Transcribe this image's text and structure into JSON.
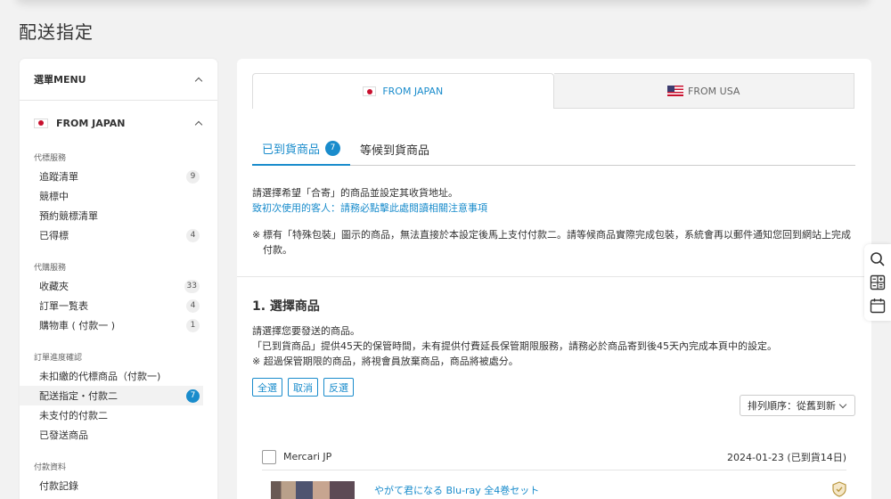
{
  "page_title": "配送指定",
  "sidebar": {
    "menu_title": "選單MENU",
    "country_label": "FROM JAPAN",
    "sections": [
      {
        "title": "代標服務",
        "items": [
          {
            "label": "追蹤清單",
            "count": "9"
          },
          {
            "label": "競標中",
            "count": ""
          },
          {
            "label": "預約競標清單",
            "count": ""
          },
          {
            "label": "已得標",
            "count": "4"
          }
        ]
      },
      {
        "title": "代購服務",
        "items": [
          {
            "label": "收藏夾",
            "count": "33"
          },
          {
            "label": "訂單一覧表",
            "count": "4"
          },
          {
            "label": "購物車 ( 付款一 )",
            "count": "1"
          }
        ]
      },
      {
        "title": "訂單進度確認",
        "items": [
          {
            "label": "未扣繳的代標商品（付款一)",
            "count": ""
          },
          {
            "label": "配送指定・付款二",
            "count": "7"
          },
          {
            "label": "未支付的付款二",
            "count": ""
          },
          {
            "label": "已發送商品",
            "count": ""
          }
        ]
      },
      {
        "title": "付款資料",
        "items": [
          {
            "label": "付款記錄",
            "count": ""
          },
          {
            "label": "押金",
            "count": ""
          }
        ]
      }
    ]
  },
  "country_tabs": [
    {
      "label": "FROM JAPAN",
      "active": true
    },
    {
      "label": "FROM USA",
      "active": false
    }
  ],
  "sub_tabs": [
    {
      "label": "已到貨商品",
      "count": "7",
      "active": true
    },
    {
      "label": "等候到貨商品",
      "active": false
    }
  ],
  "intro": {
    "line1": "請選擇希望「合寄」的商品並設定其收貨地址。",
    "link": "致初次使用的客人：請務必點擊此處閱讀相關注意事項"
  },
  "note": {
    "mark": "※",
    "text": "標有「特殊包裝」圖示的商品，無法直接於本設定後馬上支付付款二。請等候商品實際完成包裝，系統會再以郵件通知您回到網站上完成付款。"
  },
  "section1": {
    "title": "1. 選擇商品",
    "desc1": "請選擇您要發送的商品。",
    "desc2": "「已到貨商品」提供45天的保管時間，未有提供付費延長保管期限服務，請務必於商品寄到後45天內完成本頁中的設定。",
    "desc3": "※ 超過保管期限的商品，將視會員放棄商品，商品將被處分。"
  },
  "buttons": {
    "select_all": "全選",
    "cancel": "取消",
    "invert": "反選"
  },
  "sort": {
    "label": "排列順序：從舊到新"
  },
  "store": {
    "name": "Mercari JP",
    "date": "2024-01-23 (已到貨14日)"
  },
  "item": {
    "title": "やがて君になる Blu-ray 全4巻セット"
  },
  "colors": {
    "accent": "#1a8ccc",
    "jp_red": "#c8102e"
  },
  "icons": [
    "search-icon",
    "calculator-icon",
    "calendar-icon",
    "shield-icon",
    "checkbox-icon"
  ]
}
